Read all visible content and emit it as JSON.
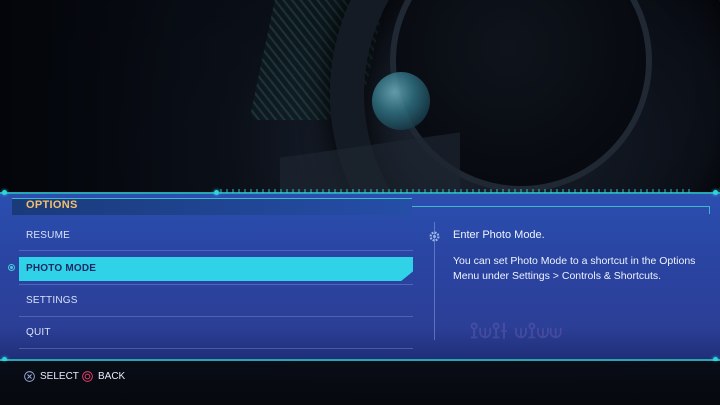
{
  "menu": {
    "title": "OPTIONS",
    "items": [
      {
        "label": "RESUME",
        "selected": false
      },
      {
        "label": "PHOTO MODE",
        "selected": true
      },
      {
        "label": "SETTINGS",
        "selected": false
      },
      {
        "label": "QUIT",
        "selected": false
      }
    ]
  },
  "description": {
    "title": "Enter Photo Mode.",
    "body": "You can set Photo Mode to a shortcut in the Options Menu under Settings > Controls & Shortcuts."
  },
  "footer": {
    "select_label": "SELECT",
    "back_label": "BACK",
    "select_icon": "cross-button-icon",
    "back_icon": "circle-button-icon"
  },
  "colors": {
    "panel": "#2b4fb0",
    "highlight": "#30d2e8",
    "accent_line": "#28a7b3",
    "title": "#f2c06b",
    "back_button": "#e0406a"
  }
}
